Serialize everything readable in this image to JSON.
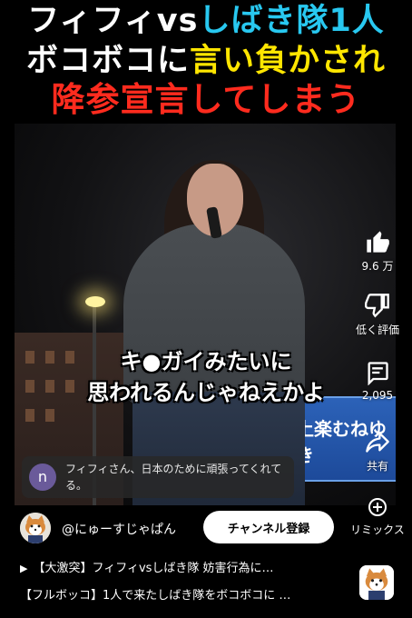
{
  "headline": {
    "line1_a": "フィフィvs",
    "line1_b": "しばき隊1人",
    "line2_a": "ボコボコに",
    "line2_b": "言い負かされ",
    "line3": "降参宣言してしまう"
  },
  "video": {
    "sign_text": "上楽むねゆき",
    "subtitle_line1": "キ●ガイみたいに",
    "subtitle_line2": "思われるんじゃねえかよ"
  },
  "comment": {
    "avatar_letter": "n",
    "text": "フィフィさん、日本のために頑張ってくれてる。"
  },
  "actions": {
    "like_count": "9.6 万",
    "dislike_label": "低く評価",
    "comment_count": "2,095",
    "share_label": "共有",
    "remix_label": "リミックス"
  },
  "channel": {
    "name": "@にゅーすじゃぱん",
    "subscribe_label": "チャンネル登録"
  },
  "titles": {
    "line1": "【大激突】フィフィvsしばき隊 妨害行為に…",
    "line2": "【フルボッコ】1人で来たしばき隊をボコボコに …"
  },
  "colors": {
    "headline_cyan": "#28c8f0",
    "headline_yellow": "#ffe600",
    "headline_red": "#ff2b1e"
  }
}
